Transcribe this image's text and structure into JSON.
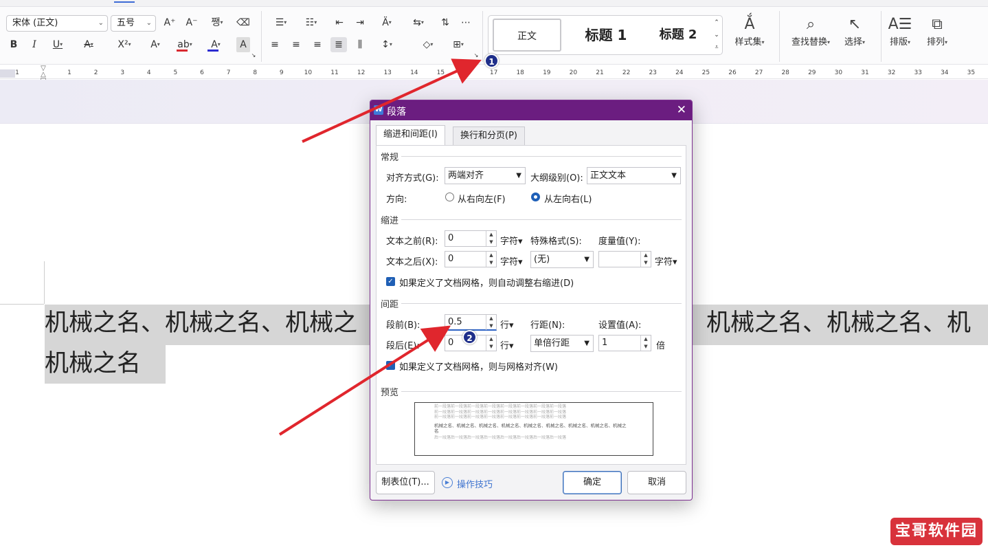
{
  "ribbon": {
    "font_name": "宋体 (正文)",
    "font_size": "五号",
    "font_icons": [
      "grow-font-icon",
      "shrink-font-icon",
      "pinyin-icon",
      "clear-format-icon"
    ],
    "format_icons": [
      "bold-icon",
      "italic-icon",
      "underline-icon",
      "strikethrough-icon",
      "superscript-icon",
      "text-effect-icon",
      "highlight-icon",
      "font-color-icon",
      "char-shading-icon"
    ],
    "bold": "B",
    "italic": "I",
    "underline": "U",
    "strike": "A",
    "superscript": "X²",
    "text_effect": "A",
    "highlight": "ab",
    "font_color": "A",
    "char_shading": "A",
    "highlight_color": "#d8282f",
    "font_color_value": "#2b2bd0",
    "styles": {
      "normal": "正文",
      "heading1": "标题  1",
      "heading2": "标题  2"
    },
    "style_set": "样式集",
    "find_replace": "查找替换",
    "select": "选择",
    "layout": "排版",
    "arrange": "排列"
  },
  "ruler": {
    "numbers": [
      "1",
      "1",
      "2",
      "3",
      "4",
      "5",
      "6",
      "7",
      "8",
      "9",
      "10",
      "11",
      "12",
      "13",
      "14",
      "15",
      "16",
      "17",
      "18",
      "19",
      "20",
      "21",
      "22",
      "23",
      "24",
      "25",
      "26",
      "27",
      "28",
      "29",
      "30",
      "31",
      "32",
      "33",
      "34",
      "35"
    ]
  },
  "document": {
    "line1_left": "机械之名、机械之名、机械之",
    "line1_right": "机械之名、机械之名、机",
    "line2": "机械之名"
  },
  "dialog": {
    "title": "段落",
    "app_icon": "W",
    "close": "✕",
    "tabs": [
      "缩进和间距(I)",
      "换行和分页(P)"
    ],
    "general": {
      "section": "常规",
      "align_label": "对齐方式(G):",
      "align_value": "两端对齐",
      "outline_label": "大纲级别(O):",
      "outline_value": "正文文本",
      "direction_label": "方向:",
      "rtl": "从右向左(F)",
      "ltr": "从左向右(L)",
      "direction_selected": "ltr"
    },
    "indent": {
      "section": "缩进",
      "before_label": "文本之前(R):",
      "before_value": "0",
      "after_label": "文本之后(X):",
      "after_value": "0",
      "unit": "字符▾",
      "special_label": "特殊格式(S):",
      "special_value": "(无)",
      "measure_label": "度量值(Y):",
      "measure_value": "",
      "measure_unit": "字符▾",
      "auto_adjust": "如果定义了文档网格，则自动调整右缩进(D)",
      "auto_adjust_checked": true
    },
    "spacing": {
      "section": "间距",
      "before_label": "段前(B):",
      "before_value": "0.5",
      "after_label": "段后(E):",
      "after_value": "0",
      "unit": "行▾",
      "line_label": "行距(N):",
      "line_value": "单倍行距",
      "setting_label": "设置值(A):",
      "setting_value": "1",
      "setting_unit": "倍",
      "grid_align": "如果定义了文档网格，则与网格对齐(W)",
      "grid_align_checked": true
    },
    "preview": {
      "section": "预览",
      "prev_lines": [
        "前一段落前一段落前一段落前一段落前一段落前一段落前一段落前一段落",
        "前一段落前一段落前一段落前一段落前一段落前一段落前一段落前一段落",
        "前一段落前一段落前一段落前一段落前一段落前一段落前一段落前一段落"
      ],
      "main_text": "机械之名、机械之名、机械之名、机械之名、机械之名、机械之名、机械之名、机械之名、机械之名",
      "next_line": "后一段落后一段落后一段落后一段落后一段落后一段落后一段落后一段落"
    },
    "tabs_button": "制表位(T)...",
    "tips": "操作技巧",
    "ok": "确定",
    "cancel": "取消"
  },
  "annotations": {
    "marker1": "1",
    "marker2": "2",
    "arrow_color": "#e0262d"
  },
  "watermark": "宝哥软件园"
}
